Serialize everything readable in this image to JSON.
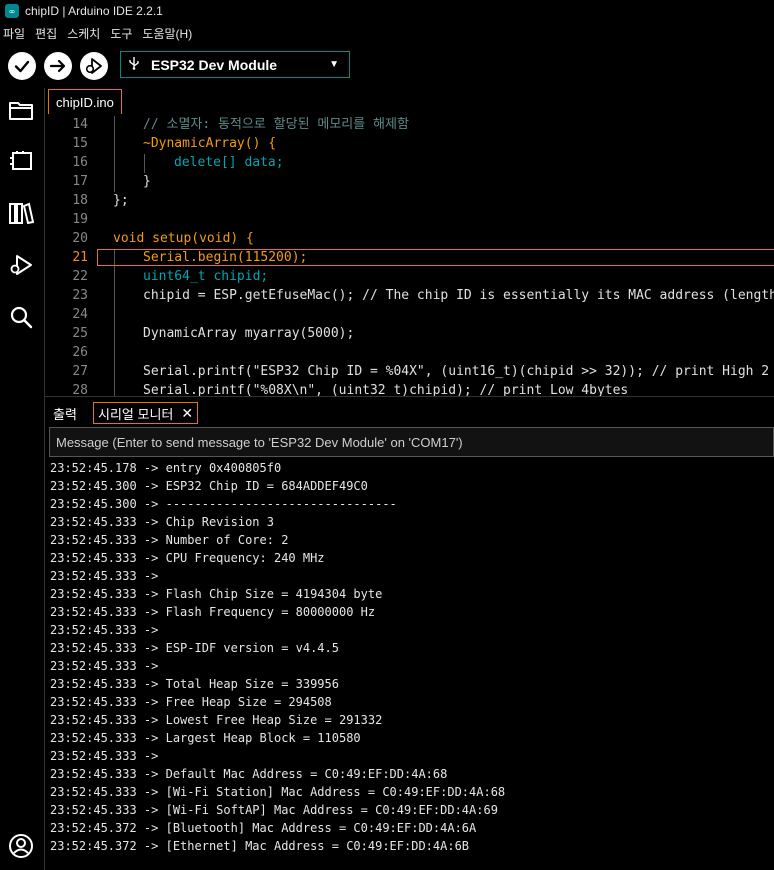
{
  "window": {
    "title": "chipID | Arduino IDE 2.2.1",
    "app_icon": "∞"
  },
  "menu": [
    "파일",
    "편집",
    "스케치",
    "도구",
    "도움말(H)"
  ],
  "toolbar": {
    "board": "ESP32 Dev Module",
    "board_icon": "usb-icon"
  },
  "tabs": {
    "file": "chipID.ino"
  },
  "editor": {
    "lines": [
      {
        "n": "14",
        "t": "// 소멸자: 동적으로 할당된 메모리를 해제함"
      },
      {
        "n": "15",
        "t": "~DynamicArray() {"
      },
      {
        "n": "16",
        "t": "delete[] data;"
      },
      {
        "n": "17",
        "t": "}"
      },
      {
        "n": "18",
        "t": "};"
      },
      {
        "n": "19",
        "t": ""
      },
      {
        "n": "20",
        "t": "void setup(void) {"
      },
      {
        "n": "21",
        "t": "Serial.begin(115200);"
      },
      {
        "n": "22",
        "t": "uint64_t chipid;"
      },
      {
        "n": "23",
        "t": "chipid = ESP.getEfuseMac(); // The chip ID is essentially its MAC address (length:"
      },
      {
        "n": "24",
        "t": ""
      },
      {
        "n": "25",
        "t": "DynamicArray myarray(5000);"
      },
      {
        "n": "26",
        "t": ""
      },
      {
        "n": "27",
        "t": "Serial.printf(\"ESP32 Chip ID = %04X\", (uint16_t)(chipid >> 32)); // print High 2 b"
      },
      {
        "n": "28",
        "t": "Serial.printf(\"%08X\\n\", (uint32_t)chipid); // print Low 4bytes"
      }
    ],
    "active_line": "21"
  },
  "panel": {
    "output_tab": "출력",
    "monitor_tab": "시리얼 모니터",
    "message_placeholder": "Message (Enter to send message to 'ESP32 Dev Module' on 'COM17')"
  },
  "monitor_lines": [
    "23:52:45.178 -> entry 0x400805f0",
    "23:52:45.300 -> ESP32 Chip ID = 684ADDEF49C0",
    "23:52:45.300 -> --------------------------------",
    "23:52:45.333 -> Chip Revision 3",
    "23:52:45.333 -> Number of Core: 2",
    "23:52:45.333 -> CPU Frequency: 240 MHz",
    "23:52:45.333 -> ",
    "23:52:45.333 -> Flash Chip Size = 4194304 byte",
    "23:52:45.333 -> Flash Frequency = 80000000 Hz",
    "23:52:45.333 -> ",
    "23:52:45.333 -> ESP-IDF version = v4.4.5",
    "23:52:45.333 -> ",
    "23:52:45.333 -> Total Heap Size = 339956",
    "23:52:45.333 -> Free Heap Size = 294508",
    "23:52:45.333 -> Lowest Free Heap Size = 291332",
    "23:52:45.333 -> Largest Heap Block = 110580",
    "23:52:45.333 -> ",
    "23:52:45.333 -> Default Mac Address = C0:49:EF:DD:4A:68",
    "23:52:45.333 -> [Wi-Fi Station] Mac Address = C0:49:EF:DD:4A:68",
    "23:52:45.333 -> [Wi-Fi SoftAP] Mac Address = C0:49:EF:DD:4A:69",
    "23:52:45.372 -> [Bluetooth] Mac Address = C0:49:EF:DD:4A:6A",
    "23:52:45.372 -> [Ethernet] Mac Address = C0:49:EF:DD:4A:6B"
  ],
  "colors": {
    "accent": "#00878f",
    "highlight": "#e07b00",
    "background": "#000000"
  }
}
